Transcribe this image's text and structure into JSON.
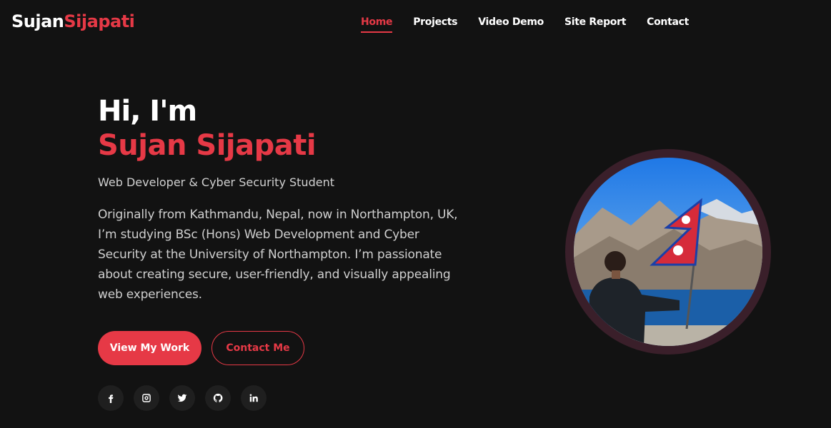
{
  "logo": {
    "first": "Sujan",
    "last": "Sijapati"
  },
  "nav": {
    "items": [
      {
        "label": "Home",
        "active": true
      },
      {
        "label": "Projects",
        "active": false
      },
      {
        "label": "Video Demo",
        "active": false
      },
      {
        "label": "Site Report",
        "active": false
      },
      {
        "label": "Contact",
        "active": false
      }
    ]
  },
  "hero": {
    "greeting": "Hi, I'm",
    "name": "Sujan Sijapati",
    "subtitle": "Web Developer & Cyber Security Student",
    "bio": "Originally from Kathmandu, Nepal, now in Northampton, UK, I’m studying BSc (Hons) Web Development and Cyber Security at the University of Northampton. I’m passionate about creating secure, user-friendly, and visually appealing web experiences."
  },
  "buttons": {
    "primary": "View My Work",
    "secondary": "Contact Me"
  },
  "socials": [
    "facebook-icon",
    "instagram-icon",
    "twitter-icon",
    "github-icon",
    "linkedin-icon"
  ],
  "colors": {
    "accent": "#e63946",
    "background": "#121212",
    "ring": "#3a1f2a",
    "social_bg": "#1f1f1f"
  }
}
